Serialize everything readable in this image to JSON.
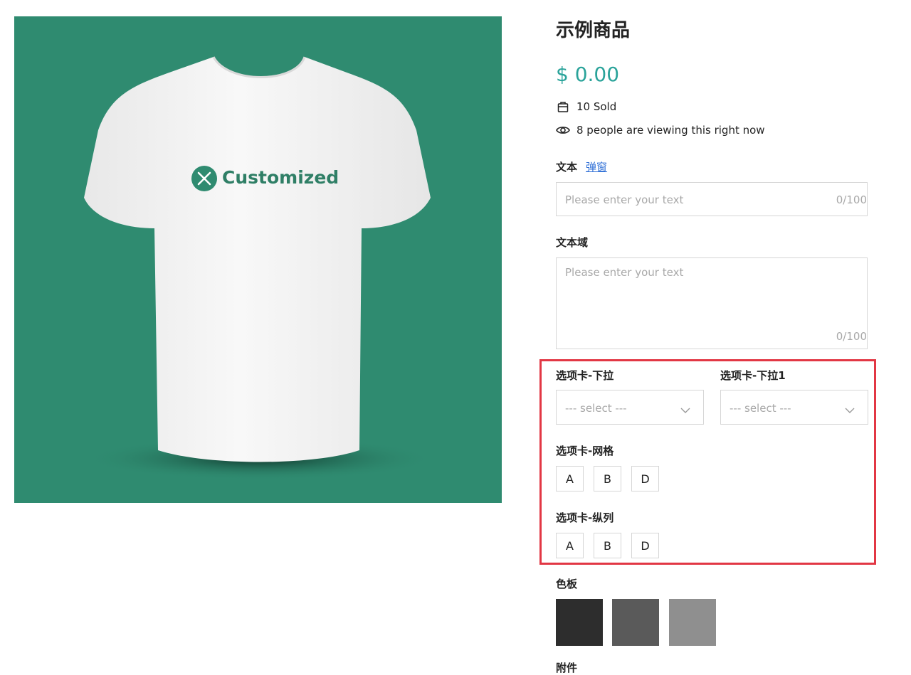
{
  "product": {
    "title": "示例商品",
    "price": "$ 0.00",
    "sold": "10 Sold",
    "viewing": "8 people are viewing this right now",
    "image_text": "Customized",
    "image_bg": "#2f8b70"
  },
  "text_field": {
    "label": "文本",
    "link": "弹窗",
    "placeholder": "Please enter your text",
    "counter": "0/100"
  },
  "textarea_field": {
    "label": "文本域",
    "placeholder": "Please enter your text",
    "counter": "0/100"
  },
  "dropdowns": [
    {
      "label": "选项卡-下拉",
      "placeholder": "--- select ---"
    },
    {
      "label": "选项卡-下拉1",
      "placeholder": "--- select ---"
    }
  ],
  "grid_options": {
    "label": "选项卡-网格",
    "options": [
      "A",
      "B",
      "D"
    ]
  },
  "column_options": {
    "label": "选项卡-纵列",
    "options": [
      "A",
      "B",
      "D"
    ]
  },
  "palette": {
    "label": "色板",
    "colors": [
      "#2d2d2d",
      "#5a5a5a",
      "#8f8f8f"
    ]
  },
  "next_section_label": "附件",
  "accent_color": "#2aa39a",
  "highlight_color": "#e23744"
}
